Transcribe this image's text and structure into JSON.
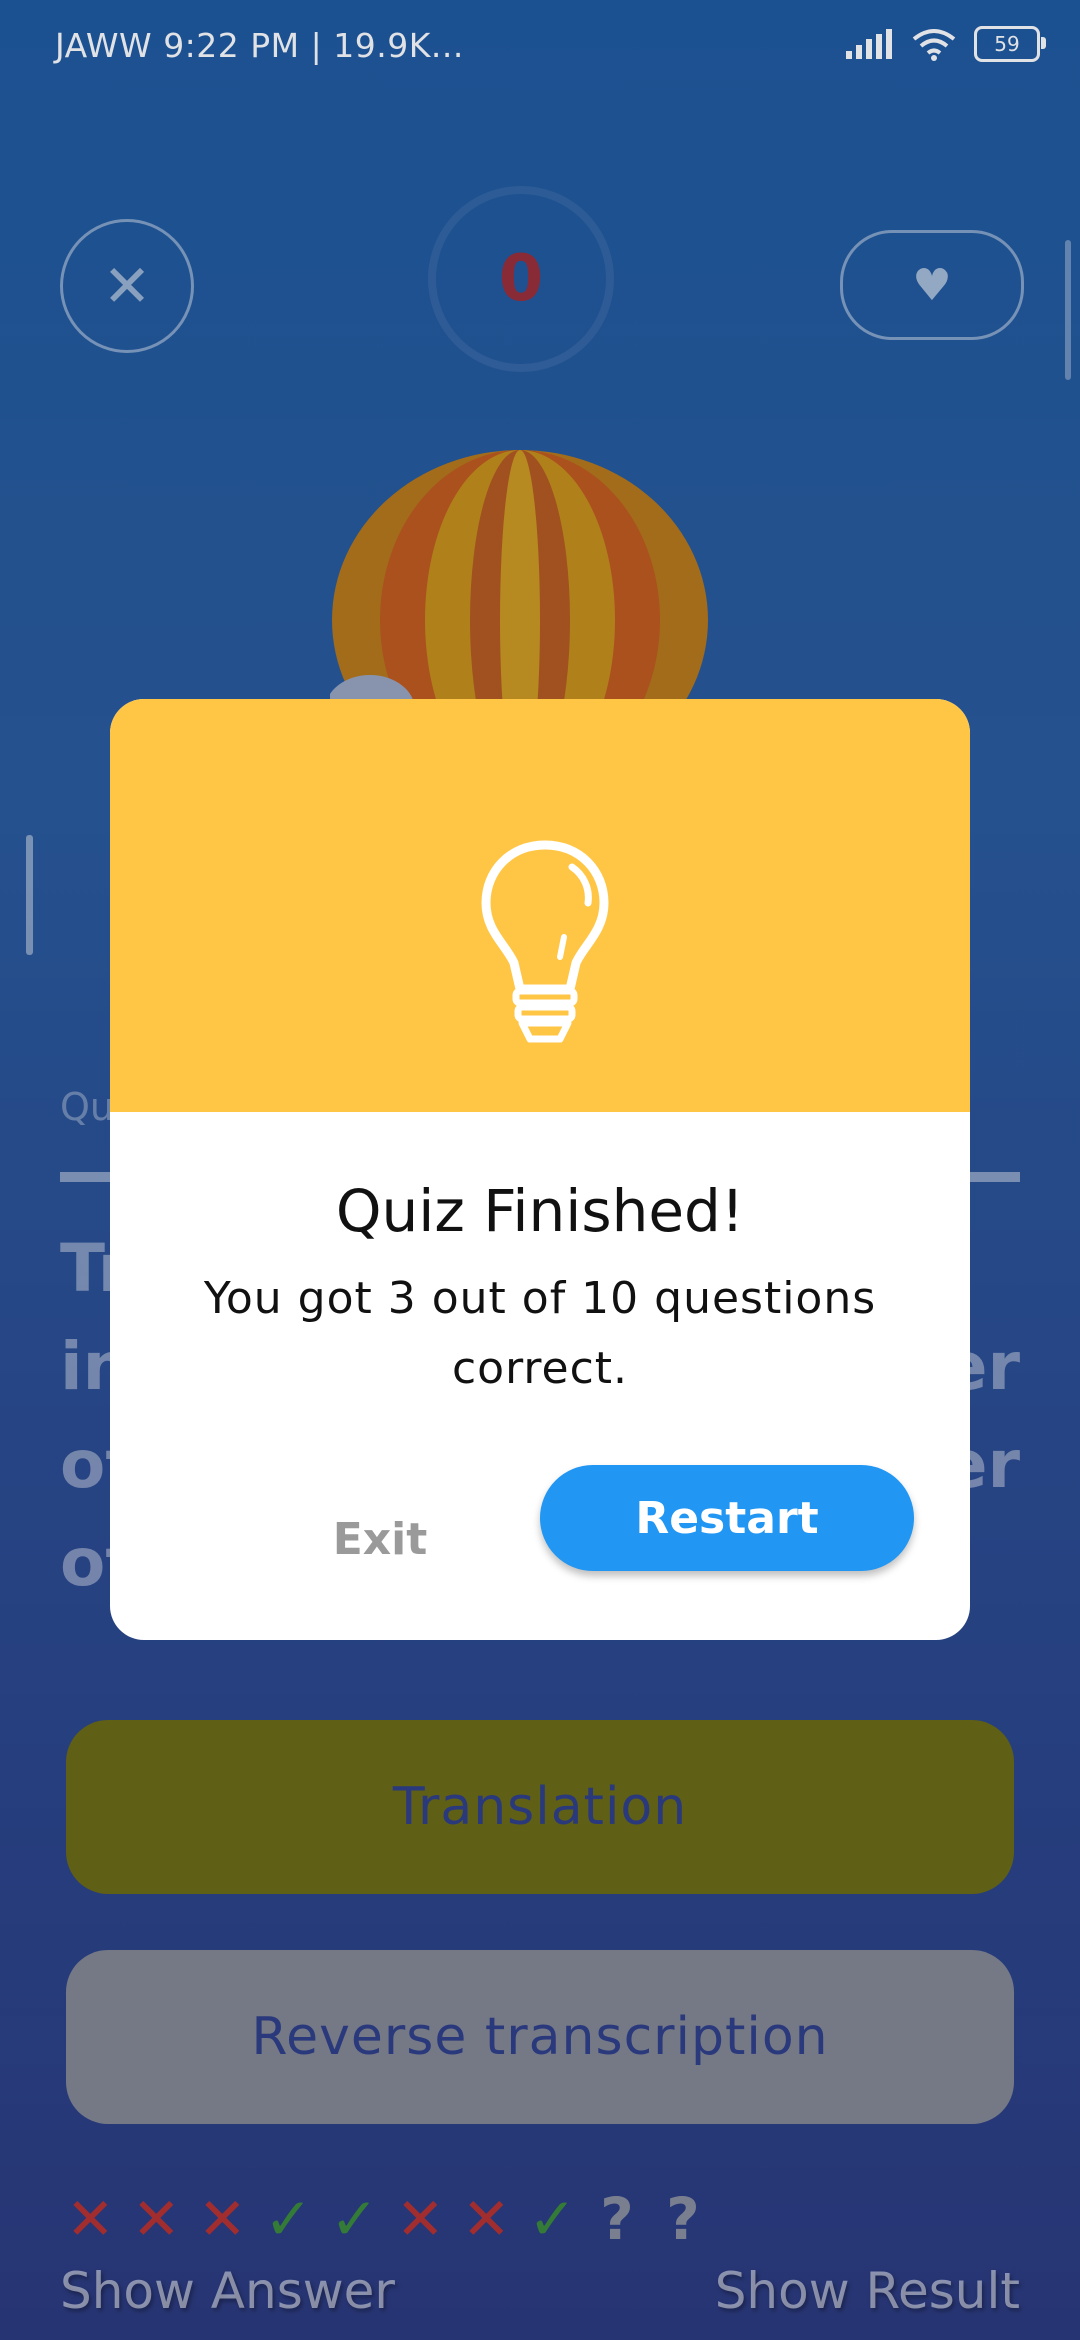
{
  "status_bar": {
    "carrier": "JAWW",
    "time_info": "9:22 PM | 19.9K...",
    "battery": "59"
  },
  "quiz": {
    "score": "0",
    "question_label": "Qu",
    "question_fragments": [
      "Tr",
      "in",
      "er",
      "ot",
      "er",
      "ot"
    ],
    "options": [
      "Translation",
      "Reverse transcription"
    ],
    "answer_marks": [
      {
        "symbol": "✕",
        "color": "#b8312f"
      },
      {
        "symbol": "✕",
        "color": "#b8312f"
      },
      {
        "symbol": "✕",
        "color": "#b8312f"
      },
      {
        "symbol": "✓",
        "color": "#3b8a3a"
      },
      {
        "symbol": "✓",
        "color": "#3b8a3a"
      },
      {
        "symbol": "✕",
        "color": "#b8312f"
      },
      {
        "symbol": "✕",
        "color": "#b8312f"
      },
      {
        "symbol": "✓",
        "color": "#3b8a3a"
      },
      {
        "symbol": "?",
        "color": "#8a8f9e"
      },
      {
        "symbol": "?",
        "color": "#8a8f9e"
      }
    ],
    "show_answer": "Show Answer",
    "show_result": "Show Result"
  },
  "dialog": {
    "title": "Quiz Finished!",
    "message": "You got 3 out of 10 questions correct.",
    "exit_label": "Exit",
    "restart_label": "Restart",
    "header_color": "#ffc645",
    "button_color": "#2196f3"
  }
}
